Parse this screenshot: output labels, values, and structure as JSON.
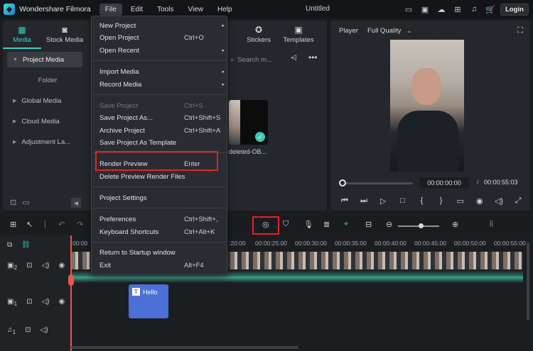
{
  "app": {
    "name": "Wondershare Filmora",
    "doc_title": "Untitled",
    "login": "Login"
  },
  "menubar": [
    "File",
    "Edit",
    "Tools",
    "View",
    "Help"
  ],
  "toptabs": [
    {
      "label": "Media"
    },
    {
      "label": "Stock Media"
    },
    {
      "label": "Stickers"
    },
    {
      "label": "Templates"
    }
  ],
  "sidenav": [
    "Project Media",
    "Folder",
    "Global Media",
    "Cloud Media",
    "Adjustment La..."
  ],
  "search_placeholder": "Search m...",
  "clip_label": "deleted-OB...",
  "player": {
    "label": "Player",
    "quality": "Full Quality",
    "current": "00:00:00:00",
    "separator": "/",
    "total": "00:00:55:03"
  },
  "file_menu": {
    "new_project": "New Project",
    "open_project": "Open Project",
    "open_project_sc": "Ctrl+O",
    "open_recent": "Open Recent",
    "import_media": "Import Media",
    "record_media": "Record Media",
    "save_project": "Save Project",
    "save_project_sc": "Ctrl+S",
    "save_as": "Save Project As...",
    "save_as_sc": "Ctrl+Shift+S",
    "archive": "Archive Project",
    "archive_sc": "Ctrl+Shift+A",
    "save_template": "Save Project As Template",
    "render_preview": "Render Preview",
    "render_preview_sc": "Enter",
    "delete_render": "Delete Preview Render Files",
    "project_settings": "Project Settings",
    "preferences": "Preferences",
    "preferences_sc": "Ctrl+Shift+,",
    "shortcuts": "Keyboard Shortcuts",
    "shortcuts_sc": "Ctrl+Alt+K",
    "startup": "Return to Startup window",
    "exit": "Exit",
    "exit_sc": "Alt+F4"
  },
  "ruler": [
    "00:00",
    ":20:00",
    "00:00:25:00",
    "00:00:30:00",
    "00:00:35:00",
    "00:00:40:00",
    "00:00:45:00",
    "00:00:50:00",
    "00:00:55:00"
  ],
  "tracks": {
    "video2": "2",
    "video1": "1",
    "audio1": "1"
  },
  "title_clip": "Hello"
}
